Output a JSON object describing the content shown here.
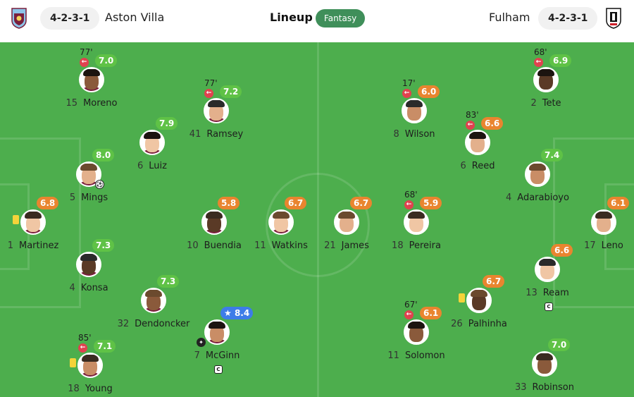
{
  "header": {
    "title": "Lineup",
    "fantasy_label": "Fantasy",
    "home": {
      "name": "Aston Villa",
      "formation": "4-2-3-1"
    },
    "away": {
      "name": "Fulham",
      "formation": "4-2-3-1"
    }
  },
  "colors": {
    "pitch": "#4cae4c",
    "rating_good": "#5fc246",
    "rating_avg": "#e9852f",
    "rating_top": "#3d7ce8",
    "sub": "#e0424f",
    "fantasy": "#3f8f5a"
  },
  "home_players": [
    {
      "num": "1",
      "name": "Martinez",
      "rating": "6.8",
      "tone": "orange",
      "yellow": true
    },
    {
      "num": "15",
      "name": "Moreno",
      "rating": "7.0",
      "tone": "green",
      "sub": "77'"
    },
    {
      "num": "5",
      "name": "Mings",
      "rating": "8.0",
      "tone": "green",
      "goal": true
    },
    {
      "num": "4",
      "name": "Konsa",
      "rating": "7.3",
      "tone": "green"
    },
    {
      "num": "18",
      "name": "Young",
      "rating": "7.1",
      "tone": "green",
      "sub": "85'",
      "yellow": true
    },
    {
      "num": "6",
      "name": "Luiz",
      "rating": "7.9",
      "tone": "green"
    },
    {
      "num": "32",
      "name": "Dendoncker",
      "rating": "7.3",
      "tone": "green"
    },
    {
      "num": "41",
      "name": "Ramsey",
      "rating": "7.2",
      "tone": "green",
      "sub": "77'"
    },
    {
      "num": "10",
      "name": "Buendia",
      "rating": "5.8",
      "tone": "orange"
    },
    {
      "num": "7",
      "name": "McGinn",
      "rating": "8.4",
      "tone": "blue",
      "star": true,
      "captain": true,
      "assist": true
    },
    {
      "num": "11",
      "name": "Watkins",
      "rating": "6.7",
      "tone": "orange"
    }
  ],
  "away_players": [
    {
      "num": "17",
      "name": "Leno",
      "rating": "6.1",
      "tone": "orange"
    },
    {
      "num": "2",
      "name": "Tete",
      "rating": "6.9",
      "tone": "green",
      "sub": "68'"
    },
    {
      "num": "4",
      "name": "Adarabioyo",
      "rating": "7.4",
      "tone": "green"
    },
    {
      "num": "13",
      "name": "Ream",
      "rating": "6.6",
      "tone": "orange",
      "captain": true
    },
    {
      "num": "33",
      "name": "Robinson",
      "rating": "7.0",
      "tone": "green"
    },
    {
      "num": "6",
      "name": "Reed",
      "rating": "6.6",
      "tone": "orange",
      "sub": "83'"
    },
    {
      "num": "26",
      "name": "Palhinha",
      "rating": "6.7",
      "tone": "orange",
      "yellow": true
    },
    {
      "num": "8",
      "name": "Wilson",
      "rating": "6.0",
      "tone": "orange",
      "sub": "17'"
    },
    {
      "num": "18",
      "name": "Pereira",
      "rating": "5.9",
      "tone": "orange",
      "sub": "68'"
    },
    {
      "num": "11",
      "name": "Solomon",
      "rating": "6.1",
      "tone": "orange",
      "sub": "67'"
    },
    {
      "num": "21",
      "name": "James",
      "rating": "6.7",
      "tone": "orange"
    }
  ]
}
